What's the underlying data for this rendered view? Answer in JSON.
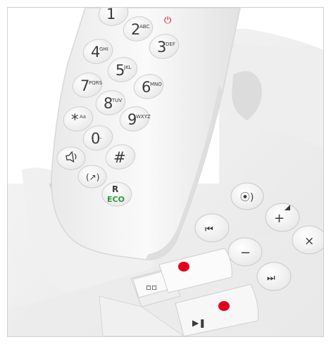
{
  "colors": {
    "body_white": "#f4f4f4",
    "key_white": "#fbfbfb",
    "key_shadow": "#c9c9c9",
    "label_dark": "#3a3a3a",
    "accent_red": "#e3001b",
    "eco_green": "#2e9a3a",
    "frame_border": "#cfcfcf"
  },
  "handset": {
    "keys": [
      {
        "digit": "1",
        "letters": "",
        "name": "key-1"
      },
      {
        "digit": "2",
        "letters": "ABC",
        "name": "key-2"
      },
      {
        "digit": "3",
        "letters": "DEF",
        "name": "key-3"
      },
      {
        "digit": "4",
        "letters": "GHI",
        "name": "key-4"
      },
      {
        "digit": "5",
        "letters": "JKL",
        "name": "key-5"
      },
      {
        "digit": "6",
        "letters": "MNO",
        "name": "key-6"
      },
      {
        "digit": "7",
        "letters": "PQRS",
        "name": "key-7"
      },
      {
        "digit": "8",
        "letters": "TUV",
        "name": "key-8"
      },
      {
        "digit": "9",
        "letters": "WXYZ",
        "name": "key-9"
      },
      {
        "digit": "*",
        "letters": "Aa",
        "name": "key-star"
      },
      {
        "digit": "0",
        "letters": "_",
        "name": "key-0"
      },
      {
        "digit": "#",
        "letters": "",
        "name": "key-hash"
      }
    ],
    "special_keys": {
      "speaker_icon": "speaker-icon",
      "intercom_icon": "intercom-icon",
      "r_label": "R",
      "eco_label": "ECO"
    }
  },
  "base": {
    "buttons": {
      "page_icon": "page-handset-icon",
      "previous_icon": "skip-back-icon",
      "volume_up_label": "+",
      "volume_minus_label": "−",
      "delete_label": "×",
      "next_icon": "skip-forward-icon",
      "answer_machine_icon": "voicemail-icon",
      "play_pause_icon": "play-pause-icon"
    }
  }
}
